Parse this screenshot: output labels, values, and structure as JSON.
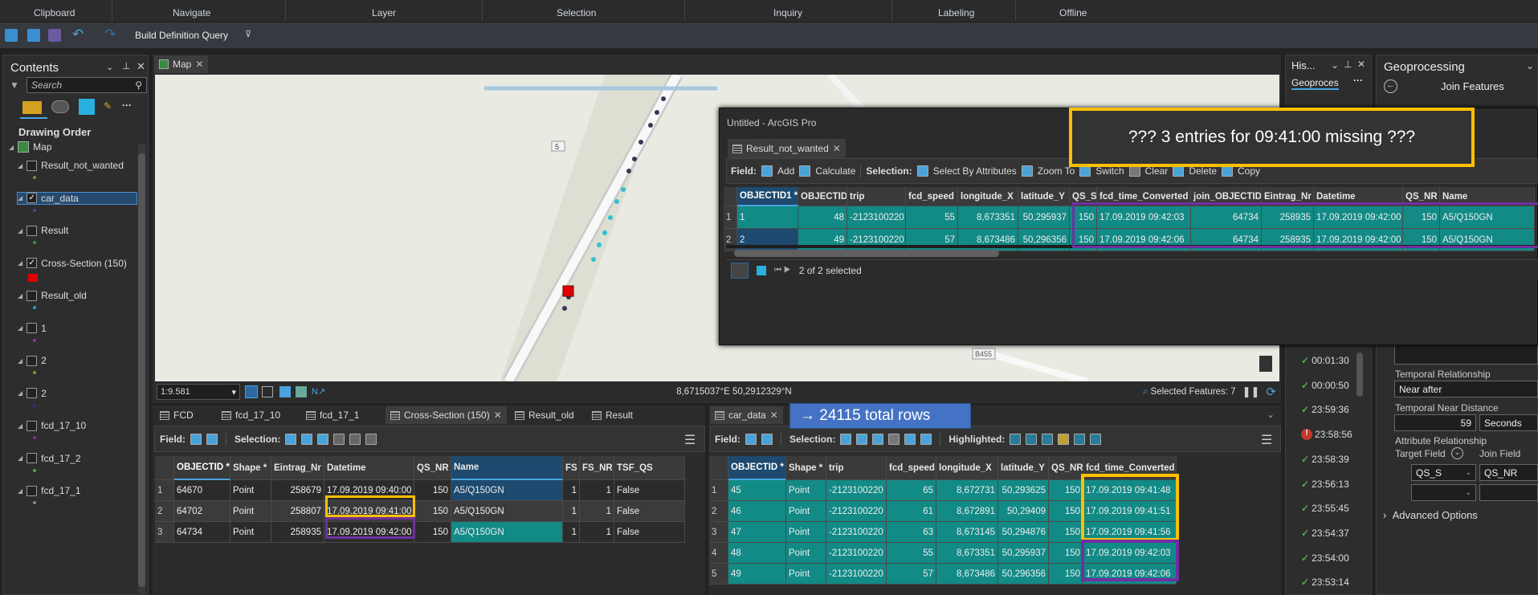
{
  "ribbon": {
    "groups": [
      "Clipboard",
      "Navigate",
      "Layer",
      "Selection",
      "Inquiry",
      "Labeling",
      "Offline"
    ]
  },
  "quick_access": {
    "command": "Build Definition Query"
  },
  "contents": {
    "title": "Contents",
    "search_placeholder": "Search",
    "section": "Drawing Order",
    "map_label": "Map",
    "layers": [
      {
        "name": "Result_not_wanted",
        "checked": false,
        "color": "#8a8a20"
      },
      {
        "name": "car_data",
        "checked": true,
        "color": "#5a3aa0"
      },
      {
        "name": "Result",
        "checked": false,
        "color": "#2a9a4a"
      },
      {
        "name": "Cross-Section (150)",
        "checked": true,
        "color": "#e00000"
      },
      {
        "name": "Result_old",
        "checked": false,
        "color": "#2aa0c0"
      },
      {
        "name": "1",
        "checked": false,
        "color": "#9030b0"
      },
      {
        "name": "2",
        "checked": false,
        "color": "#a09020"
      },
      {
        "name": "2",
        "checked": false,
        "color": "#4020a0"
      },
      {
        "name": "fcd_17_10",
        "checked": false,
        "color": "#8030a0"
      },
      {
        "name": "fcd_17_2",
        "checked": false,
        "color": "#60a030"
      },
      {
        "name": "fcd_17_1",
        "checked": false,
        "color": "#888"
      }
    ]
  },
  "map": {
    "tab": "Map",
    "road_label_1": "5",
    "road_label_2": "B455",
    "scale": "1:9.581",
    "coordinates": "8,6715037°E 50,2912329°N",
    "selected_features": "Selected Features: 7"
  },
  "floating": {
    "title": "Untitled - ArcGIS Pro",
    "tab": "Result_not_wanted",
    "toolbar": {
      "field": "Field:",
      "add": "Add",
      "calculate": "Calculate",
      "selection": "Selection:",
      "select_by_attributes": "Select By Attributes",
      "zoom_to": "Zoom To",
      "switch": "Switch",
      "clear": "Clear",
      "delete": "Delete",
      "copy": "Copy"
    },
    "columns": [
      "OBJECTID1 *",
      "OBJECTID",
      "trip",
      "fcd_speed",
      "longitude_X",
      "latitude_Y",
      "QS_S",
      "fcd_time_Converted",
      "join_OBJECTID",
      "Eintrag_Nr",
      "Datetime",
      "QS_NR",
      "Name"
    ],
    "rows": [
      [
        "1",
        "48",
        "-2123100220",
        "55",
        "8,673351",
        "50,295937",
        "150",
        "17.09.2019 09:42:03",
        "64734",
        "258935",
        "17.09.2019 09:42:00",
        "150",
        "A5/Q150GN"
      ],
      [
        "2",
        "49",
        "-2123100220",
        "57",
        "8,673486",
        "50,296356",
        "150",
        "17.09.2019 09:42:06",
        "64734",
        "258935",
        "17.09.2019 09:42:00",
        "150",
        "A5/Q150GN"
      ]
    ],
    "status": "2 of 2 selected"
  },
  "annotations": {
    "missing": "??? 3 entries for 09:41:00 missing ???",
    "total_rows": "→ 24115 total rows",
    "highlight_yellow": "#ffc000",
    "highlight_purple": "#7030a0"
  },
  "history": {
    "title": "His...",
    "tab": "Geoproces",
    "entries": [
      {
        "time": "00:01:30",
        "status": "success"
      },
      {
        "time": "00:00:50",
        "status": "success"
      },
      {
        "time": "23:59:36",
        "status": "success"
      },
      {
        "time": "23:58:56",
        "status": "error"
      },
      {
        "time": "23:58:39",
        "status": "success"
      },
      {
        "time": "23:56:13",
        "status": "success"
      },
      {
        "time": "23:55:45",
        "status": "success"
      },
      {
        "time": "23:54:37",
        "status": "success"
      },
      {
        "time": "23:54:00",
        "status": "success"
      },
      {
        "time": "23:53:14",
        "status": "success"
      }
    ]
  },
  "geoprocessing": {
    "title": "Geoprocessing",
    "tool": "Join Features",
    "temporal_relationship_label": "Temporal Relationship",
    "temporal_relationship": "Near after",
    "temporal_near_distance_label": "Temporal Near Distance",
    "temporal_near_distance": "59",
    "temporal_unit": "Seconds",
    "attribute_relationship_label": "Attribute Relationship",
    "target_field_label": "Target Field",
    "join_field_label": "Join Field",
    "target_field": "QS_S",
    "join_field": "QS_NR",
    "advanced_options": "Advanced Options"
  },
  "bottom_tabs_left": [
    "FCD",
    "fcd_17_10",
    "fcd_17_1",
    "Cross-Section (150)",
    "Result_old",
    "Result"
  ],
  "cross_section": {
    "toolbar": {
      "field": "Field:",
      "selection": "Selection:"
    },
    "columns": [
      "OBJECTID *",
      "Shape *",
      "Eintrag_Nr",
      "Datetime",
      "QS_NR",
      "Name",
      "FS",
      "FS_NR",
      "TSF_QS"
    ],
    "rows": [
      [
        "64670",
        "Point",
        "258679",
        "17.09.2019 09:40:00",
        "150",
        "A5/Q150GN",
        "1",
        "1",
        "False"
      ],
      [
        "64702",
        "Point",
        "258807",
        "17.09.2019 09:41:00",
        "150",
        "A5/Q150GN",
        "1",
        "1",
        "False"
      ],
      [
        "64734",
        "Point",
        "258935",
        "17.09.2019 09:42:00",
        "150",
        "A5/Q150GN",
        "1",
        "1",
        "False"
      ]
    ]
  },
  "car_data": {
    "tab": "car_data",
    "toolbar": {
      "field": "Field:",
      "selection": "Selection:",
      "highlighted": "Highlighted:"
    },
    "columns": [
      "OBJECTID *",
      "Shape *",
      "trip",
      "fcd_speed",
      "longitude_X",
      "latitude_Y",
      "QS_NR",
      "fcd_time_Converted"
    ],
    "rows": [
      [
        "45",
        "Point",
        "-2123100220",
        "65",
        "8,672731",
        "50,293625",
        "150",
        "17.09.2019 09:41:48"
      ],
      [
        "46",
        "Point",
        "-2123100220",
        "61",
        "8,672891",
        "50,29409",
        "150",
        "17.09.2019 09:41:51"
      ],
      [
        "47",
        "Point",
        "-2123100220",
        "63",
        "8,673145",
        "50,294876",
        "150",
        "17.09.2019 09:41:56"
      ],
      [
        "48",
        "Point",
        "-2123100220",
        "55",
        "8,673351",
        "50,295937",
        "150",
        "17.09.2019 09:42:03"
      ],
      [
        "49",
        "Point",
        "-2123100220",
        "57",
        "8,673486",
        "50,296356",
        "150",
        "17.09.2019 09:42:06"
      ]
    ]
  }
}
